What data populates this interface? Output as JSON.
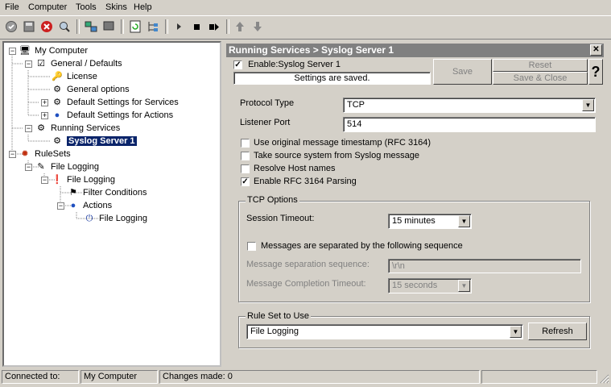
{
  "menu": {
    "file": "File",
    "computer": "Computer",
    "tools": "Tools",
    "skins": "Skins",
    "help": "Help"
  },
  "tree": {
    "my_computer": "My Computer",
    "general_defaults": "General / Defaults",
    "license": "License",
    "general_options": "General options",
    "default_services": "Default Settings for Services",
    "default_actions": "Default Settings for Actions",
    "running_services": "Running Services",
    "syslog_server_1": "Syslog Server 1",
    "rulesets": "RuleSets",
    "file_logging_ruleset": "File Logging",
    "file_logging_rule": "File Logging",
    "filter_conditions": "Filter Conditions",
    "actions": "Actions",
    "file_logging_action": "File Logging"
  },
  "panel": {
    "title": "Running Services > Syslog Server 1",
    "close": "✕",
    "enable_label": "Enable:Syslog Server 1",
    "enable_checked": true,
    "status_text": "Settings are saved.",
    "save": "Save",
    "reset": "Reset",
    "save_close": "Save & Close",
    "help": "?"
  },
  "form": {
    "protocol_type_label": "Protocol Type",
    "protocol_type_value": "TCP",
    "listener_port_label": "Listener Port",
    "listener_port_value": "514",
    "opt_original_timestamp": "Use original message timestamp (RFC 3164)",
    "opt_source_system": "Take source system from Syslog message",
    "opt_resolve_hosts": "Resolve Host names",
    "opt_rfc3164_parsing": "Enable RFC 3164 Parsing",
    "opt_rfc3164_checked": "✓"
  },
  "tcp": {
    "group_title": "TCP Options",
    "session_timeout_label": "Session Timeout:",
    "session_timeout_value": "15 minutes",
    "separated_label": "Messages are separated by the following sequence",
    "sep_sequence_label": "Message separation sequence:",
    "sep_sequence_value": "\\r\\n",
    "completion_timeout_label": "Message Completion Timeout:",
    "completion_timeout_value": "15 seconds"
  },
  "ruleset": {
    "group_title": "Rule Set to Use",
    "value": "File Logging",
    "refresh": "Refresh"
  },
  "status": {
    "connected_label": "Connected to:",
    "connected_value": "My Computer",
    "changes": "Changes made: 0"
  }
}
